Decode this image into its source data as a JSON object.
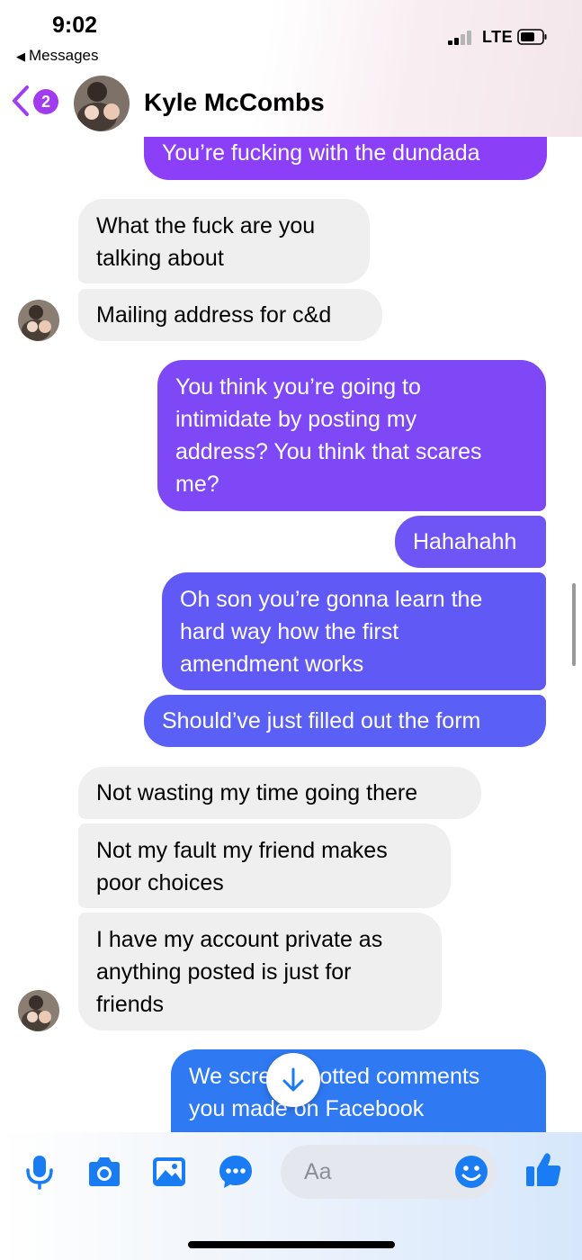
{
  "status_bar": {
    "time": "9:02",
    "back_app_label": "Messages",
    "network": "LTE"
  },
  "header": {
    "unread_count": "2",
    "contact_name": "Kyle McCombs"
  },
  "colors": {
    "outgoing_purple": "#8b3ff7",
    "outgoing_violet": "#7a4ff6",
    "outgoing_indigo": "#5b5ef5",
    "outgoing_blue": "#2f7af3",
    "incoming": "#efeff0",
    "accent": "#1a7cf2",
    "badge": "#a13bf0"
  },
  "messages": [
    {
      "from": "me",
      "text": "You’re fucking with the dundada"
    },
    {
      "from": "them",
      "text": "What the fuck are you\ntalking about"
    },
    {
      "from": "them",
      "text": "Mailing address for c&d"
    },
    {
      "from": "me",
      "text": "You think you’re going to\nintimidate by posting my\naddress? You think that scares\nme?"
    },
    {
      "from": "me",
      "text": "Hahahahh"
    },
    {
      "from": "me",
      "text": "Oh son you’re gonna learn the\nhard way how the first\namendment works"
    },
    {
      "from": "me",
      "text": "Should’ve just filled out the form"
    },
    {
      "from": "them",
      "text": "Not wasting my time going there"
    },
    {
      "from": "them",
      "text": "Not my fault my friend makes\npoor choices"
    },
    {
      "from": "them",
      "text": "I have my account private as\nanything posted is just for\nfriends"
    },
    {
      "from": "me",
      "text": "We screenshotted comments\nyou made on Facebook"
    }
  ],
  "composer": {
    "placeholder": "Aa",
    "icons": [
      "microphone-icon",
      "camera-icon",
      "gallery-icon",
      "more-icon",
      "emoji-icon",
      "thumbs-up-icon"
    ]
  }
}
